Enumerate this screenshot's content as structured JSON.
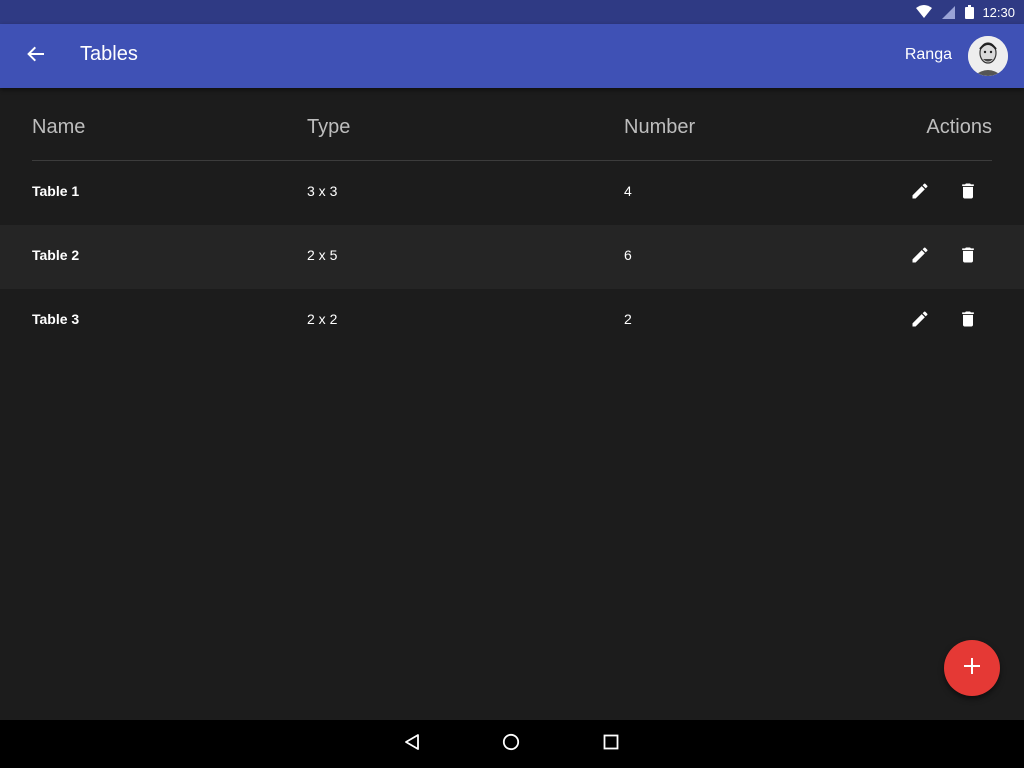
{
  "status_bar": {
    "time": "12:30",
    "icons": [
      "wifi-icon",
      "cell-signal-icon",
      "battery-icon"
    ]
  },
  "app_bar": {
    "title": "Tables",
    "user_name": "Ranga",
    "back_icon": "arrow-back-icon",
    "color": "#3f51b5"
  },
  "table": {
    "headers": {
      "name": "Name",
      "type": "Type",
      "number": "Number",
      "actions": "Actions"
    },
    "rows": [
      {
        "name": "Table 1",
        "type": "3 x 3",
        "number": "4"
      },
      {
        "name": "Table 2",
        "type": "2 x 5",
        "number": "6"
      },
      {
        "name": "Table 3",
        "type": "2 x 2",
        "number": "2"
      }
    ],
    "row_actions": [
      "edit-icon",
      "delete-icon"
    ]
  },
  "fab": {
    "icon": "plus-icon",
    "color": "#e53935"
  },
  "nav_bar": {
    "buttons": [
      "nav-back-icon",
      "nav-home-icon",
      "nav-recents-icon"
    ]
  }
}
